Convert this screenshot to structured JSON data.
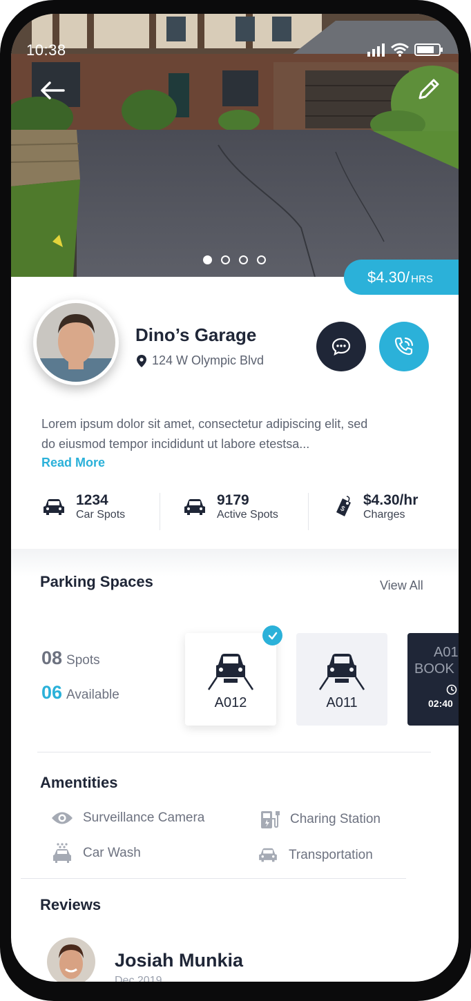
{
  "status_bar": {
    "time": "10:38"
  },
  "hero": {
    "page_count": 4,
    "active_page": 1
  },
  "price_badge": {
    "amount": "$4.30/",
    "unit": "HRS"
  },
  "profile": {
    "name": "Dino’s Garage",
    "address": "124 W Olympic Blvd"
  },
  "description": {
    "line1": "Lorem ipsum dolor sit amet, consectetur adipiscing elit, sed",
    "line2": "do eiusmod tempor incididunt ut labore etestsa...",
    "read_more": "Read More"
  },
  "stats": [
    {
      "value": "1234",
      "label": "Car Spots",
      "icon": "car-icon"
    },
    {
      "value": "9179",
      "label": "Active Spots",
      "icon": "car-icon"
    },
    {
      "value": "$4.30/hr",
      "label": "Charges",
      "icon": "price-tag-icon"
    }
  ],
  "parking": {
    "title": "Parking Spaces",
    "view_all": "View All",
    "spots_count": "08",
    "spots_label": "Spots",
    "available_count": "06",
    "available_label": "Available",
    "cards": [
      {
        "code": "A012",
        "state": "selected"
      },
      {
        "code": "A011",
        "state": "free"
      },
      {
        "code": "A01",
        "state": "booked",
        "status": "BOOK",
        "time": "02:40"
      }
    ]
  },
  "amenities": {
    "title": "Amentities",
    "items": [
      {
        "label": "Surveillance Camera",
        "icon": "eye-icon"
      },
      {
        "label": "Charing Station",
        "icon": "charging-station-icon"
      },
      {
        "label": "Car Wash",
        "icon": "car-wash-icon"
      },
      {
        "label": "Transportation",
        "icon": "car-icon"
      }
    ]
  },
  "reviews": {
    "title": "Reviews",
    "reviewer_name": "Josiah Munkia",
    "reviewer_date": "Dec 2019"
  },
  "colors": {
    "accent": "#2bb1d9",
    "dark": "#1f2637",
    "muted": "#6d7280"
  }
}
